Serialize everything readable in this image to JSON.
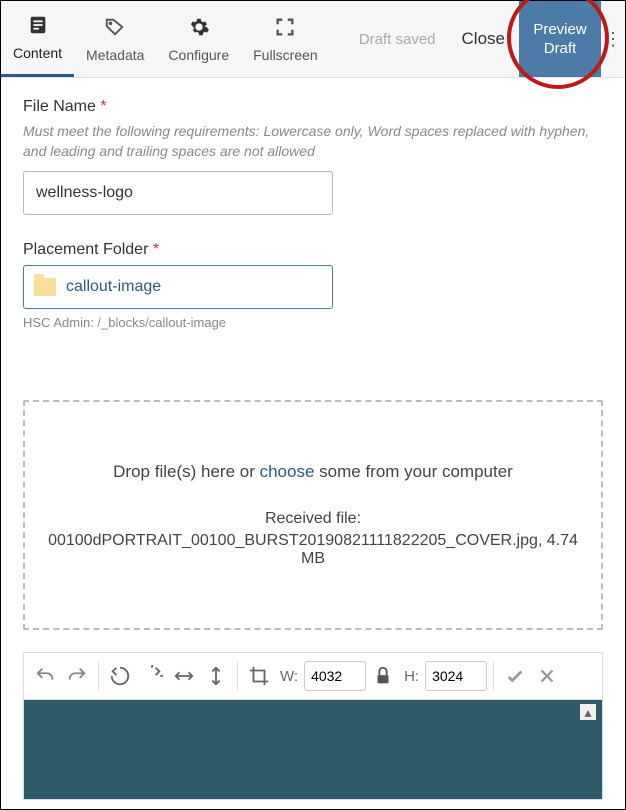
{
  "toolbar": {
    "tabs": [
      {
        "label": "Content"
      },
      {
        "label": "Metadata"
      },
      {
        "label": "Configure"
      },
      {
        "label": "Fullscreen"
      }
    ],
    "draft_saved": "Draft saved",
    "close": "Close",
    "preview": "Preview Draft"
  },
  "file_name": {
    "label": "File Name",
    "hint": "Must meet the following requirements: Lowercase only, Word spaces replaced with hyphen, and leading and trailing spaces are not allowed",
    "value": "wellness-logo"
  },
  "placement_folder": {
    "label": "Placement Folder",
    "value": "callout-image",
    "path": "HSC Admin: /_blocks/callout-image"
  },
  "dropzone": {
    "prefix": "Drop file(s) here or ",
    "choose": "choose",
    "suffix": " some from your computer",
    "received_label": "Received file:",
    "received_file": "00100dPORTRAIT_00100_BURST20190821111822205_COVER.jpg, 4.74 MB"
  },
  "editor": {
    "w_label": "W:",
    "w_value": "4032",
    "h_label": "H:",
    "h_value": "3024"
  }
}
